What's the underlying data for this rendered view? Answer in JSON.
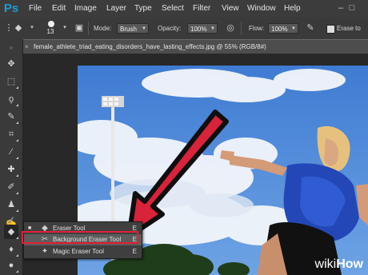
{
  "app": {
    "logo": "Ps"
  },
  "menu": [
    "File",
    "Edit",
    "Image",
    "Layer",
    "Type",
    "Select",
    "Filter",
    "View",
    "Window",
    "Help"
  ],
  "options_bar": {
    "brush_size": "13",
    "mode_label": "Mode:",
    "mode_value": "Brush",
    "opacity_label": "Opacity:",
    "opacity_value": "100%",
    "flow_label": "Flow:",
    "flow_value": "100%",
    "erase_history_label": "Erase to His"
  },
  "document": {
    "tab_title": "female_athlete_triad_eating_disorders_have_lasting_effects.jpg @ 55% (RGB/8#)",
    "close_symbol": "×"
  },
  "tool_flyout": {
    "items": [
      {
        "label": "Eraser Tool",
        "shortcut": "E",
        "active": true
      },
      {
        "label": "Background Eraser Tool",
        "shortcut": "E",
        "highlighted": true
      },
      {
        "label": "Magic Eraser Tool",
        "shortcut": "E"
      }
    ]
  },
  "colors": {
    "highlight_box": "#e21f36",
    "arrow_fill": "#d8233a",
    "arrow_outline": "#0f0f0f",
    "ps_blue": "#1e9bd4",
    "sky": "#4a86d8"
  },
  "watermark": {
    "wiki": "wiki",
    "how": "How"
  }
}
